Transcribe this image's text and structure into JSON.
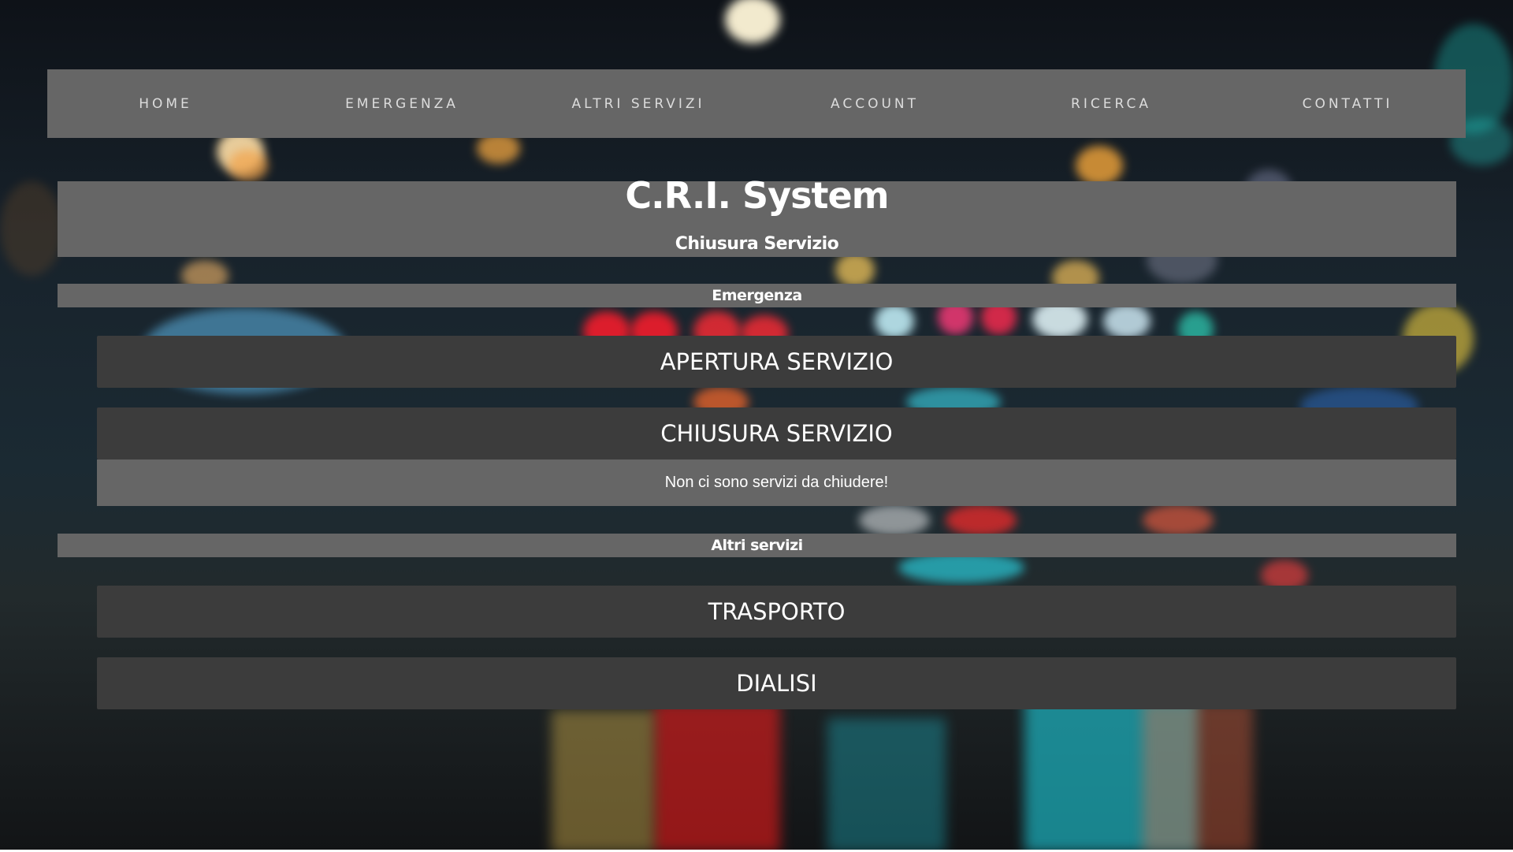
{
  "nav": {
    "items": [
      "HOME",
      "EMERGENZA",
      "ALTRI SERVIZI",
      "ACCOUNT",
      "RICERCA",
      "CONTATTI"
    ]
  },
  "header": {
    "title": "C.R.I. System",
    "subtitle": "Chiusura Servizio"
  },
  "sections": {
    "emergenza": {
      "heading": "Emergenza",
      "buttons": [
        "APERTURA SERVIZIO",
        "CHIUSURA SERVIZIO"
      ],
      "message": "Non ci sono servizi da chiudere!"
    },
    "altri_servizi": {
      "heading": "Altri servizi",
      "buttons": [
        "TRASPORTO",
        "DIALISI"
      ]
    }
  },
  "colors": {
    "panel": "#666666",
    "button": "#3c3c3c",
    "text": "#ffffff"
  }
}
